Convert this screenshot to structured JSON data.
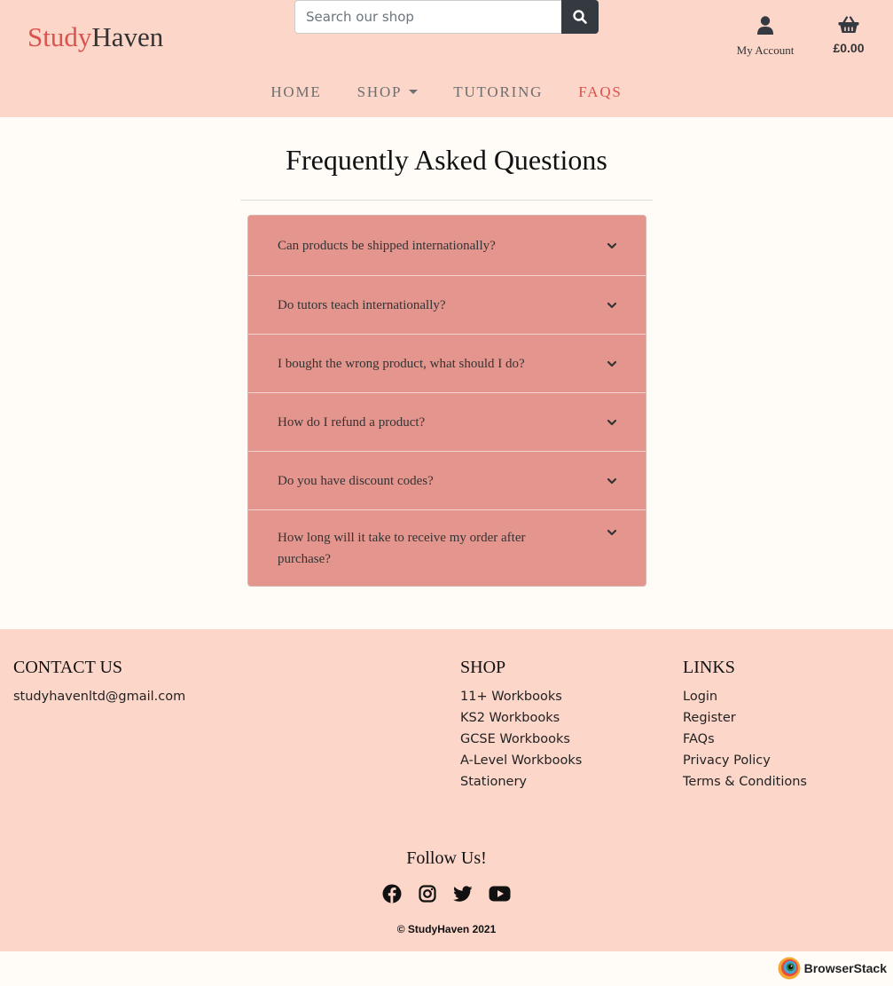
{
  "header": {
    "logo_part1": "Study",
    "logo_part2": "Haven",
    "search_placeholder": "Search our shop",
    "account_label": "My Account",
    "basket_total": "£0.00",
    "colors": {
      "background": "#fdd6ca",
      "accent": "#d9534f"
    }
  },
  "nav": {
    "items": [
      {
        "label": "HOME"
      },
      {
        "label": "SHOP"
      },
      {
        "label": "TUTORING"
      },
      {
        "label": "FAQS"
      }
    ]
  },
  "main": {
    "title": "Frequently Asked Questions",
    "faqs": [
      {
        "question": "Can products be shipped internationally?"
      },
      {
        "question": "Do tutors teach internationally?"
      },
      {
        "question": "I bought the wrong product, what should I do?"
      },
      {
        "question": "How do I refund a product?"
      },
      {
        "question": "Do you have discount codes?"
      },
      {
        "question": "How long will it take to receive my order after purchase?"
      }
    ]
  },
  "footer": {
    "contact": {
      "heading": "CONTACT US",
      "email": "studyhavenltd@gmail.com"
    },
    "shop": {
      "heading": "SHOP",
      "links": [
        "11+ Workbooks",
        "KS2 Workbooks",
        "GCSE Workbooks",
        "A-Level Workbooks",
        "Stationery"
      ]
    },
    "links": {
      "heading": "LINKS",
      "links": [
        "Login",
        "Register",
        "FAQs",
        "Privacy Policy",
        "Terms & Conditions"
      ]
    },
    "follow": "Follow Us!",
    "social_icons": [
      "facebook-icon",
      "instagram-icon",
      "twitter-icon",
      "youtube-icon"
    ],
    "copyright": "© StudyHaven 2021"
  },
  "badge": {
    "label": "BrowserStack"
  }
}
